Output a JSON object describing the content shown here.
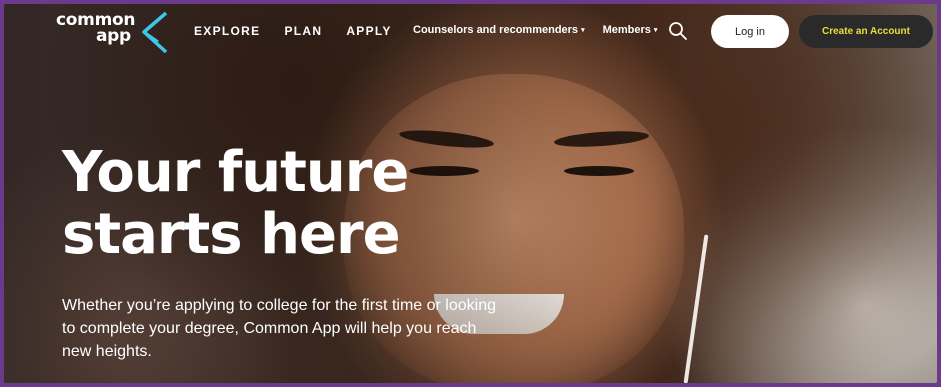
{
  "logo": {
    "line1": "common",
    "line2": "app",
    "accent_color": "#3ec6e8"
  },
  "nav": {
    "main": [
      {
        "label": "EXPLORE"
      },
      {
        "label": "PLAN"
      },
      {
        "label": "APPLY"
      }
    ],
    "secondary": [
      {
        "label": "Counselors and recommenders",
        "caret": "▾"
      },
      {
        "label": "Members",
        "caret": "▾"
      }
    ],
    "search_icon": "search-icon"
  },
  "actions": {
    "login_label": "Log in",
    "create_label": "Create an Account",
    "create_text_color": "#e8df3a"
  },
  "hero": {
    "title_line1": "Your future",
    "title_line2": "starts here",
    "subtitle": "Whether you’re applying to college for the first time or looking to complete your degree, Common App will help you reach new heights."
  }
}
